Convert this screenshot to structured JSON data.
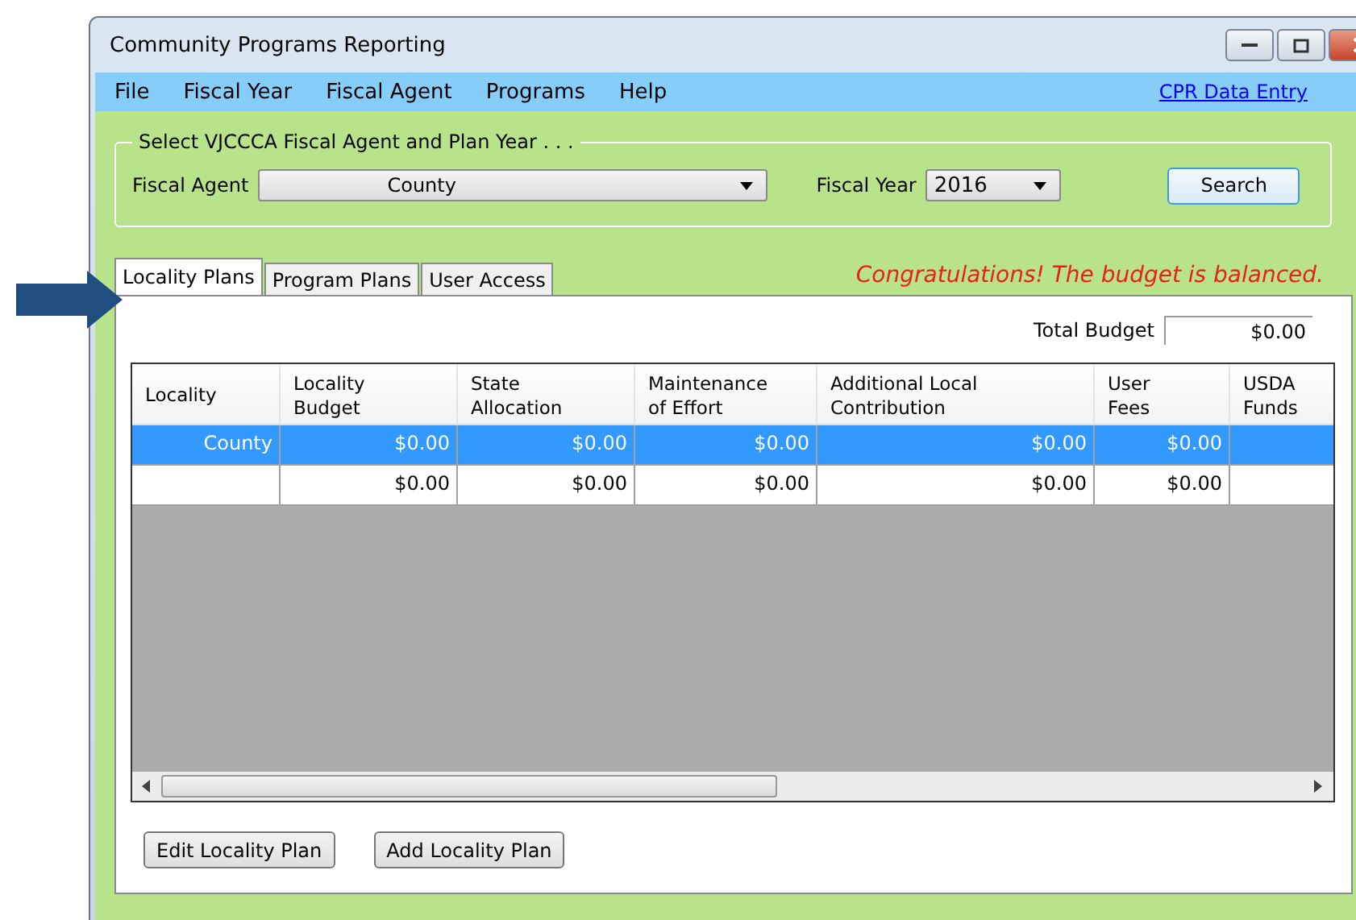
{
  "window": {
    "title": "Community Programs Reporting"
  },
  "menu": [
    "File",
    "Fiscal Year",
    "Fiscal Agent",
    "Programs",
    "Help"
  ],
  "menu_link": "CPR Data Entry",
  "selector": {
    "legend": "Select VJCCCA Fiscal Agent and Plan Year . . .",
    "agent_label": "Fiscal Agent",
    "agent_value": "County",
    "year_label": "Fiscal Year",
    "year_value": "2016",
    "search_button": "Search"
  },
  "message": "Congratulations! The budget is balanced.",
  "tabs": [
    {
      "label": "Locality Plans",
      "selected": true
    },
    {
      "label": "Program Plans",
      "selected": false
    },
    {
      "label": "User Access",
      "selected": false
    }
  ],
  "total_budget": {
    "label": "Total Budget",
    "value": "$0.00"
  },
  "table": {
    "columns": [
      "Locality",
      "Locality\nBudget",
      "State\nAllocation",
      "Maintenance\nof Effort",
      "Additional Local\nContribution",
      "User\nFees",
      "USDA\nFunds"
    ],
    "rows": [
      {
        "selected": true,
        "cells": [
          "County",
          "$0.00",
          "$0.00",
          "$0.00",
          "$0.00",
          "$0.00",
          ""
        ]
      },
      {
        "selected": false,
        "cells": [
          "",
          "$0.00",
          "$0.00",
          "$0.00",
          "$0.00",
          "$0.00",
          ""
        ]
      }
    ]
  },
  "buttons": [
    "Edit Locality Plan",
    "Add Locality Plan"
  ]
}
